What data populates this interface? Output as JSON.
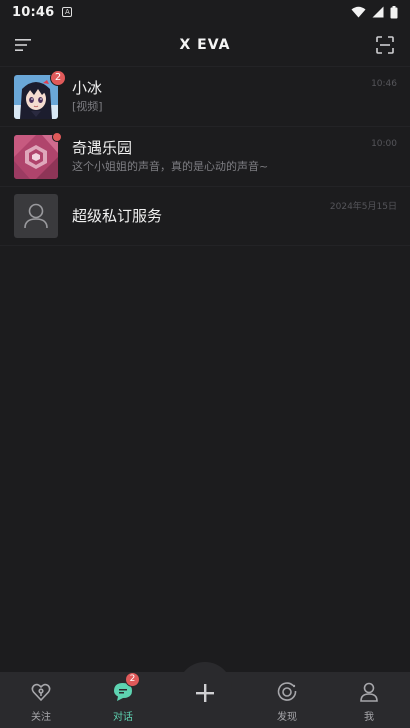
{
  "status_bar": {
    "time": "10:46",
    "notification_glyph": "A"
  },
  "header": {
    "title": "X EVA"
  },
  "conversations": [
    {
      "name": "小冰",
      "preview": "[视频]",
      "time": "10:46",
      "badge": "2"
    },
    {
      "name": "奇遇乐园",
      "preview": "这个小姐姐的声音，真的是心动的声音~",
      "time": "10:00"
    },
    {
      "name": "超级私订服务",
      "preview": "",
      "time": "2024年5月15日"
    }
  ],
  "bottom_nav": {
    "items": [
      {
        "label": "关注",
        "icon": "heart-key-icon"
      },
      {
        "label": "对话",
        "icon": "chat-icon",
        "badge": "2"
      },
      {
        "label": "",
        "icon": "plus-icon"
      },
      {
        "label": "发现",
        "icon": "discover-icon"
      },
      {
        "label": "我",
        "icon": "user-icon"
      }
    ]
  },
  "colors": {
    "background": "#1c1c1e",
    "nav_background": "#2a2a2d",
    "accent": "#5ed3b1",
    "badge": "#e05a5a"
  }
}
